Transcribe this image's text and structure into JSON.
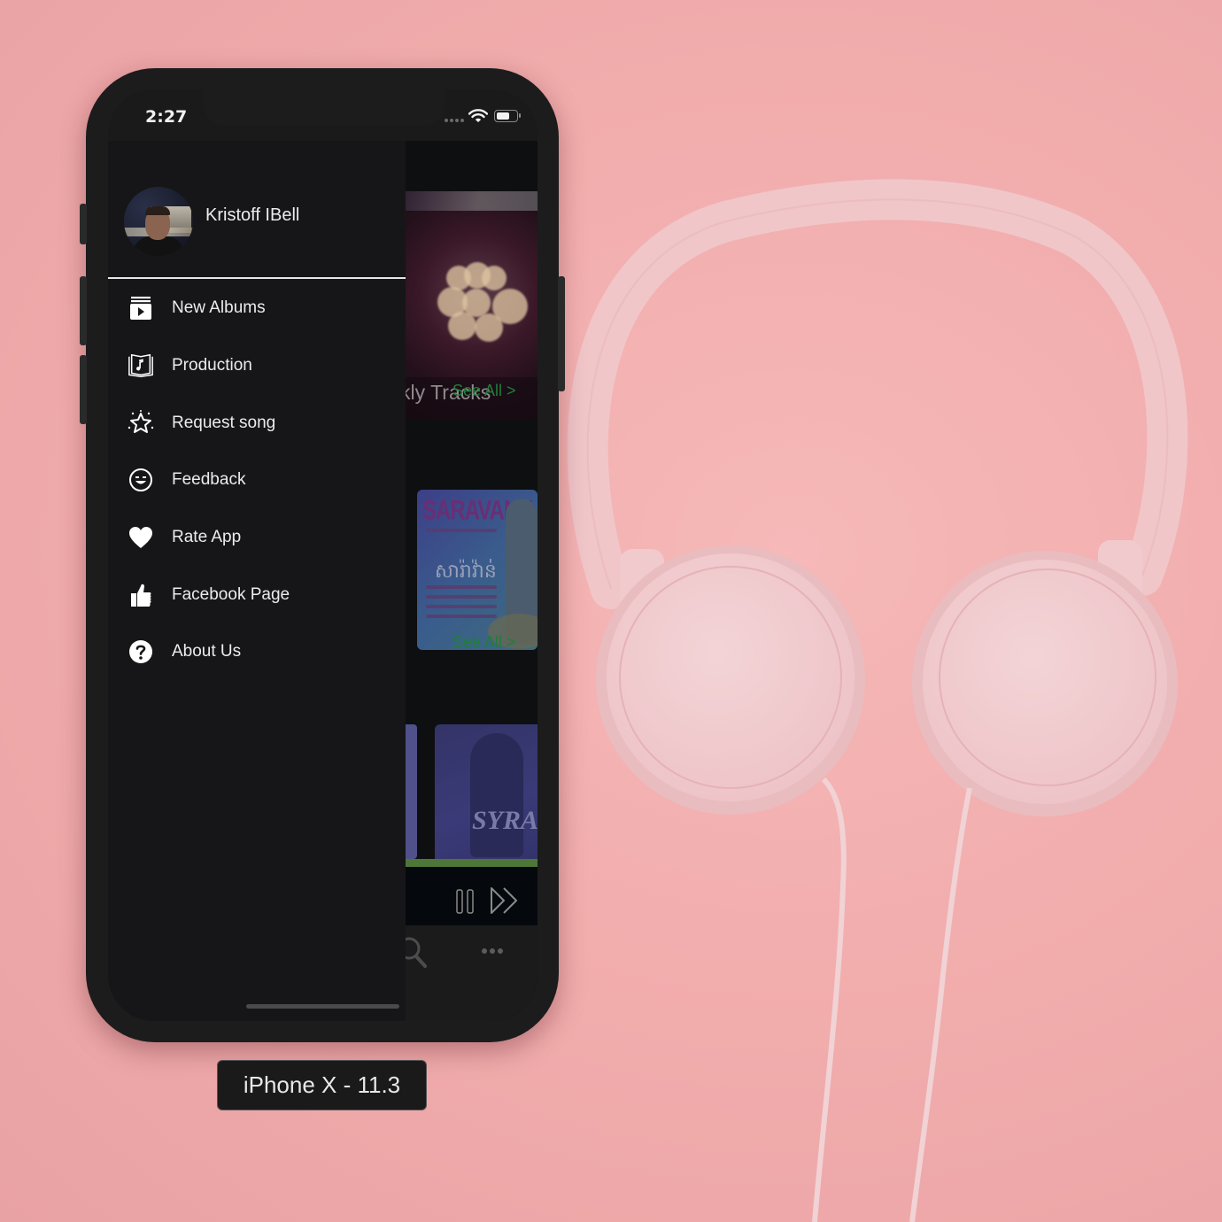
{
  "device_label": "iPhone X - 11.3",
  "status_bar": {
    "time": "2:27",
    "icons": [
      "signal-dots-icon",
      "wifi-icon",
      "battery-icon"
    ]
  },
  "drawer": {
    "user": {
      "name": "Kristoff IBell",
      "avatar": "avatar"
    },
    "menu_items": [
      {
        "label": "New Albums",
        "icon": "albums-play-icon"
      },
      {
        "label": "Production",
        "icon": "music-book-icon"
      },
      {
        "label": "Request song",
        "icon": "sparkle-star-icon"
      },
      {
        "label": "Feedback",
        "icon": "smiley-icon"
      },
      {
        "label": "Rate App",
        "icon": "heart-icon"
      },
      {
        "label": "Facebook Page",
        "icon": "thumbs-up-icon"
      },
      {
        "label": "About Us",
        "icon": "question-circle-icon"
      }
    ]
  },
  "background_app": {
    "hero_title": "kly Tracks",
    "sections": [
      {
        "see_all": "See All >"
      },
      {
        "see_all": "See All >"
      }
    ],
    "albums": [
      {
        "brand": "SARAVANN",
        "khmer_title": "សារ៉ាវ៉ាន់"
      },
      {
        "title": "SYRA"
      }
    ],
    "player": {
      "progress_fraction": 1.0,
      "controls": [
        "pause-icon",
        "next-icon"
      ]
    },
    "tabbar": {
      "icons": [
        "search-icon",
        "more-icon"
      ]
    },
    "colors": {
      "accent_green": "#1f7f3a",
      "progress_green": "#4e7638"
    }
  }
}
